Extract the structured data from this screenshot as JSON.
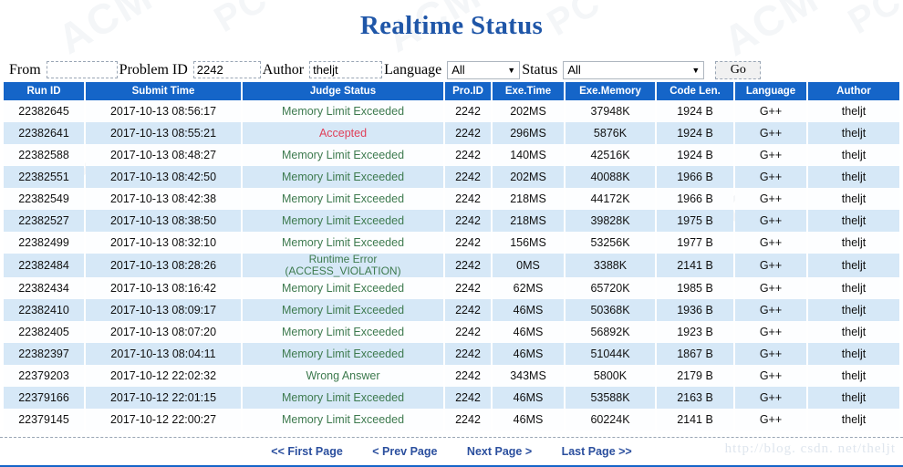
{
  "title": "Realtime Status",
  "watermark": {
    "tiles": [
      "ACM",
      "PC",
      "ACM",
      "PC",
      "ACM",
      "PC",
      "ACM",
      "PC",
      "ACM",
      "PC",
      "ACM",
      "PC"
    ],
    "footer_text": "http://blog. csdn. net/theljt"
  },
  "filter": {
    "from_label": "From",
    "from_value": "",
    "from_placeholder": "",
    "problem_label": "Problem ID",
    "problem_value": "2242",
    "author_label": "Author",
    "author_value": "theljt",
    "language_label": "Language",
    "language_value": "All",
    "status_label": "Status",
    "status_value": "All",
    "go_label": "Go",
    "arrow_glyph": "▼"
  },
  "table": {
    "columns": [
      "Run ID",
      "Submit Time",
      "Judge Status",
      "Pro.ID",
      "Exe.Time",
      "Exe.Memory",
      "Code Len.",
      "Language",
      "Author"
    ],
    "rows": [
      {
        "run_id": "22382645",
        "submit_time": "2017-10-13 08:56:17",
        "judge_status": "Memory Limit Exceeded",
        "judge_status_2": "",
        "status_kind": "ok",
        "pro_id": "2242",
        "exe_time": "202MS",
        "exe_memory": "37948K",
        "code_len": "1924 B",
        "language": "G++",
        "author": "theljt"
      },
      {
        "run_id": "22382641",
        "submit_time": "2017-10-13 08:55:21",
        "judge_status": "Accepted",
        "judge_status_2": "",
        "status_kind": "ac",
        "pro_id": "2242",
        "exe_time": "296MS",
        "exe_memory": "5876K",
        "code_len": "1924 B",
        "language": "G++",
        "author": "theljt"
      },
      {
        "run_id": "22382588",
        "submit_time": "2017-10-13 08:48:27",
        "judge_status": "Memory Limit Exceeded",
        "judge_status_2": "",
        "status_kind": "ok",
        "pro_id": "2242",
        "exe_time": "140MS",
        "exe_memory": "42516K",
        "code_len": "1924 B",
        "language": "G++",
        "author": "theljt"
      },
      {
        "run_id": "22382551",
        "submit_time": "2017-10-13 08:42:50",
        "judge_status": "Memory Limit Exceeded",
        "judge_status_2": "",
        "status_kind": "ok",
        "pro_id": "2242",
        "exe_time": "202MS",
        "exe_memory": "40088K",
        "code_len": "1966 B",
        "language": "G++",
        "author": "theljt"
      },
      {
        "run_id": "22382549",
        "submit_time": "2017-10-13 08:42:38",
        "judge_status": "Memory Limit Exceeded",
        "judge_status_2": "",
        "status_kind": "ok",
        "pro_id": "2242",
        "exe_time": "218MS",
        "exe_memory": "44172K",
        "code_len": "1966 B",
        "language": "G++",
        "author": "theljt"
      },
      {
        "run_id": "22382527",
        "submit_time": "2017-10-13 08:38:50",
        "judge_status": "Memory Limit Exceeded",
        "judge_status_2": "",
        "status_kind": "ok",
        "pro_id": "2242",
        "exe_time": "218MS",
        "exe_memory": "39828K",
        "code_len": "1975 B",
        "language": "G++",
        "author": "theljt"
      },
      {
        "run_id": "22382499",
        "submit_time": "2017-10-13 08:32:10",
        "judge_status": "Memory Limit Exceeded",
        "judge_status_2": "",
        "status_kind": "ok",
        "pro_id": "2242",
        "exe_time": "156MS",
        "exe_memory": "53256K",
        "code_len": "1977 B",
        "language": "G++",
        "author": "theljt"
      },
      {
        "run_id": "22382484",
        "submit_time": "2017-10-13 08:28:26",
        "judge_status": "Runtime Error",
        "judge_status_2": "(ACCESS_VIOLATION)",
        "status_kind": "ok",
        "pro_id": "2242",
        "exe_time": "0MS",
        "exe_memory": "3388K",
        "code_len": "2141 B",
        "language": "G++",
        "author": "theljt"
      },
      {
        "run_id": "22382434",
        "submit_time": "2017-10-13 08:16:42",
        "judge_status": "Memory Limit Exceeded",
        "judge_status_2": "",
        "status_kind": "ok",
        "pro_id": "2242",
        "exe_time": "62MS",
        "exe_memory": "65720K",
        "code_len": "1985 B",
        "language": "G++",
        "author": "theljt"
      },
      {
        "run_id": "22382410",
        "submit_time": "2017-10-13 08:09:17",
        "judge_status": "Memory Limit Exceeded",
        "judge_status_2": "",
        "status_kind": "ok",
        "pro_id": "2242",
        "exe_time": "46MS",
        "exe_memory": "50368K",
        "code_len": "1936 B",
        "language": "G++",
        "author": "theljt"
      },
      {
        "run_id": "22382405",
        "submit_time": "2017-10-13 08:07:20",
        "judge_status": "Memory Limit Exceeded",
        "judge_status_2": "",
        "status_kind": "ok",
        "pro_id": "2242",
        "exe_time": "46MS",
        "exe_memory": "56892K",
        "code_len": "1923 B",
        "language": "G++",
        "author": "theljt"
      },
      {
        "run_id": "22382397",
        "submit_time": "2017-10-13 08:04:11",
        "judge_status": "Memory Limit Exceeded",
        "judge_status_2": "",
        "status_kind": "ok",
        "pro_id": "2242",
        "exe_time": "46MS",
        "exe_memory": "51044K",
        "code_len": "1867 B",
        "language": "G++",
        "author": "theljt"
      },
      {
        "run_id": "22379203",
        "submit_time": "2017-10-12 22:02:32",
        "judge_status": "Wrong Answer",
        "judge_status_2": "",
        "status_kind": "ok",
        "pro_id": "2242",
        "exe_time": "343MS",
        "exe_memory": "5800K",
        "code_len": "2179 B",
        "language": "G++",
        "author": "theljt"
      },
      {
        "run_id": "22379166",
        "submit_time": "2017-10-12 22:01:15",
        "judge_status": "Memory Limit Exceeded",
        "judge_status_2": "",
        "status_kind": "ok",
        "pro_id": "2242",
        "exe_time": "46MS",
        "exe_memory": "53588K",
        "code_len": "2163 B",
        "language": "G++",
        "author": "theljt"
      },
      {
        "run_id": "22379145",
        "submit_time": "2017-10-12 22:00:27",
        "judge_status": "Memory Limit Exceeded",
        "judge_status_2": "",
        "status_kind": "ok",
        "pro_id": "2242",
        "exe_time": "46MS",
        "exe_memory": "60224K",
        "code_len": "2141 B",
        "language": "G++",
        "author": "theljt"
      }
    ]
  },
  "pagination": {
    "first": "<< First Page",
    "prev": "< Prev Page",
    "next": "Next Page >",
    "last": "Last Page >>"
  },
  "colors": {
    "header_blue": "#1565c8",
    "title_blue": "#1f56a8",
    "row_even": "#d6e8f7",
    "row_odd": "#fdfeff",
    "link_blue": "#2f6fa8",
    "accepted_red": "#e0415a",
    "status_green": "#3d7a4e"
  }
}
